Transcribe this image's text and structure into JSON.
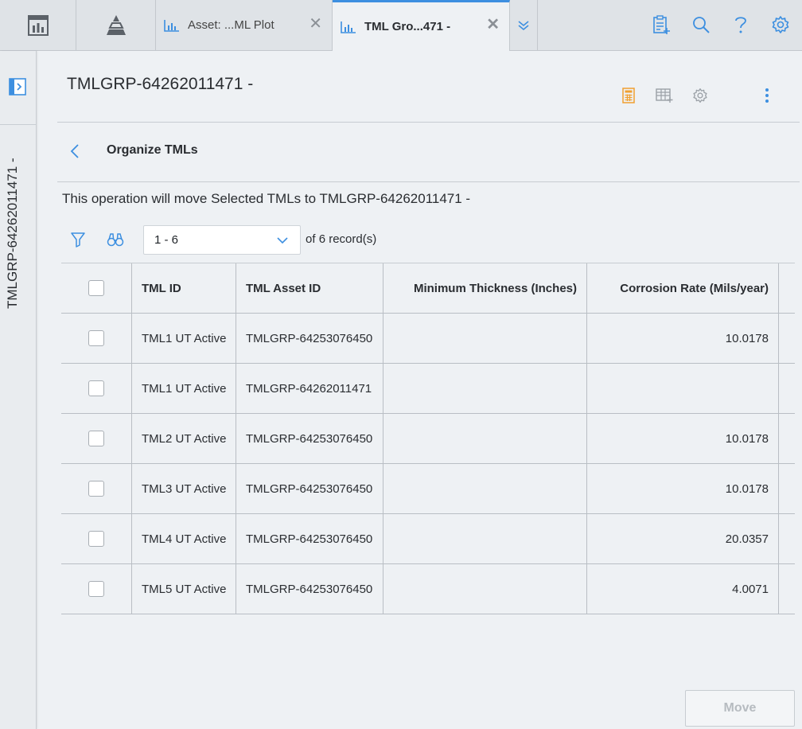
{
  "tabs": [
    {
      "label": "Asset: ...ML Plot",
      "icon": "chart-icon",
      "active": false
    },
    {
      "label": "TML Gro...471 -",
      "icon": "chart-icon",
      "active": true
    }
  ],
  "page": {
    "title": "TMLGRP-64262011471 -",
    "side_label": "TMLGRP-64262011471 -"
  },
  "section": {
    "title": "Organize TMLs",
    "description": "This operation will move Selected TMLs to TMLGRP-64262011471 -"
  },
  "pager": {
    "range": "1 - 6",
    "of_prefix": "of",
    "total": "6",
    "suffix": "record(s)"
  },
  "table": {
    "columns": [
      "TML ID",
      "TML Asset ID",
      "Minimum Thickness (Inches)",
      "Corrosion Rate (Mils/year)"
    ],
    "rows": [
      {
        "tml_id": "TML1 UT Active",
        "asset_id": "TMLGRP-64253076450",
        "min_thickness": "",
        "corrosion_rate": "10.0178"
      },
      {
        "tml_id": "TML1 UT Active",
        "asset_id": "TMLGRP-64262011471",
        "min_thickness": "",
        "corrosion_rate": ""
      },
      {
        "tml_id": "TML2 UT Active",
        "asset_id": "TMLGRP-64253076450",
        "min_thickness": "",
        "corrosion_rate": "10.0178"
      },
      {
        "tml_id": "TML3 UT Active",
        "asset_id": "TMLGRP-64253076450",
        "min_thickness": "",
        "corrosion_rate": "10.0178"
      },
      {
        "tml_id": "TML4 UT Active",
        "asset_id": "TMLGRP-64253076450",
        "min_thickness": "",
        "corrosion_rate": "20.0357"
      },
      {
        "tml_id": "TML5 UT Active",
        "asset_id": "TMLGRP-64253076450",
        "min_thickness": "",
        "corrosion_rate": "4.0071"
      }
    ]
  },
  "actions": {
    "move_label": "Move"
  },
  "colors": {
    "accent": "#3d8fe0",
    "header_icon_active": "#f0a030",
    "disabled_text": "#b6bbc0"
  }
}
